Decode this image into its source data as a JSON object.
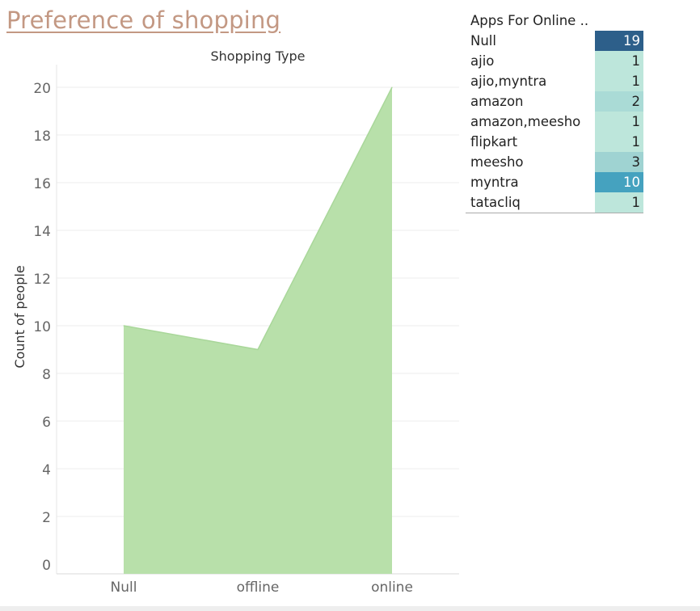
{
  "page": {
    "title": "Preference of shopping"
  },
  "chart_data": [
    {
      "type": "area",
      "title": "Shopping Type",
      "xlabel": "",
      "ylabel": "Count of people",
      "categories": [
        "Null",
        "offline",
        "online"
      ],
      "values": [
        10,
        9,
        20
      ],
      "ylim": [
        0,
        20
      ],
      "yticks": [
        0,
        2,
        4,
        6,
        8,
        10,
        12,
        14,
        16,
        18,
        20
      ],
      "grid": true,
      "color": "#b8e0aa"
    },
    {
      "type": "table",
      "title": "Apps For Online ..",
      "rows": [
        {
          "label": "Null",
          "value": 19,
          "color": "#2d5f8a",
          "text_color": "#ffffff"
        },
        {
          "label": "ajio",
          "value": 1,
          "color": "#bde6db",
          "text_color": "#222222"
        },
        {
          "label": "ajio,myntra",
          "value": 1,
          "color": "#bde6db",
          "text_color": "#222222"
        },
        {
          "label": "amazon",
          "value": 2,
          "color": "#aadbd6",
          "text_color": "#222222"
        },
        {
          "label": "amazon,meesho",
          "value": 1,
          "color": "#bde6db",
          "text_color": "#222222"
        },
        {
          "label": "flipkart",
          "value": 1,
          "color": "#bde6db",
          "text_color": "#222222"
        },
        {
          "label": "meesho",
          "value": 3,
          "color": "#9fd3d2",
          "text_color": "#222222"
        },
        {
          "label": "myntra",
          "value": 10,
          "color": "#45a2bf",
          "text_color": "#ffffff"
        },
        {
          "label": "tatacliq",
          "value": 1,
          "color": "#bde6db",
          "text_color": "#222222"
        }
      ]
    }
  ]
}
